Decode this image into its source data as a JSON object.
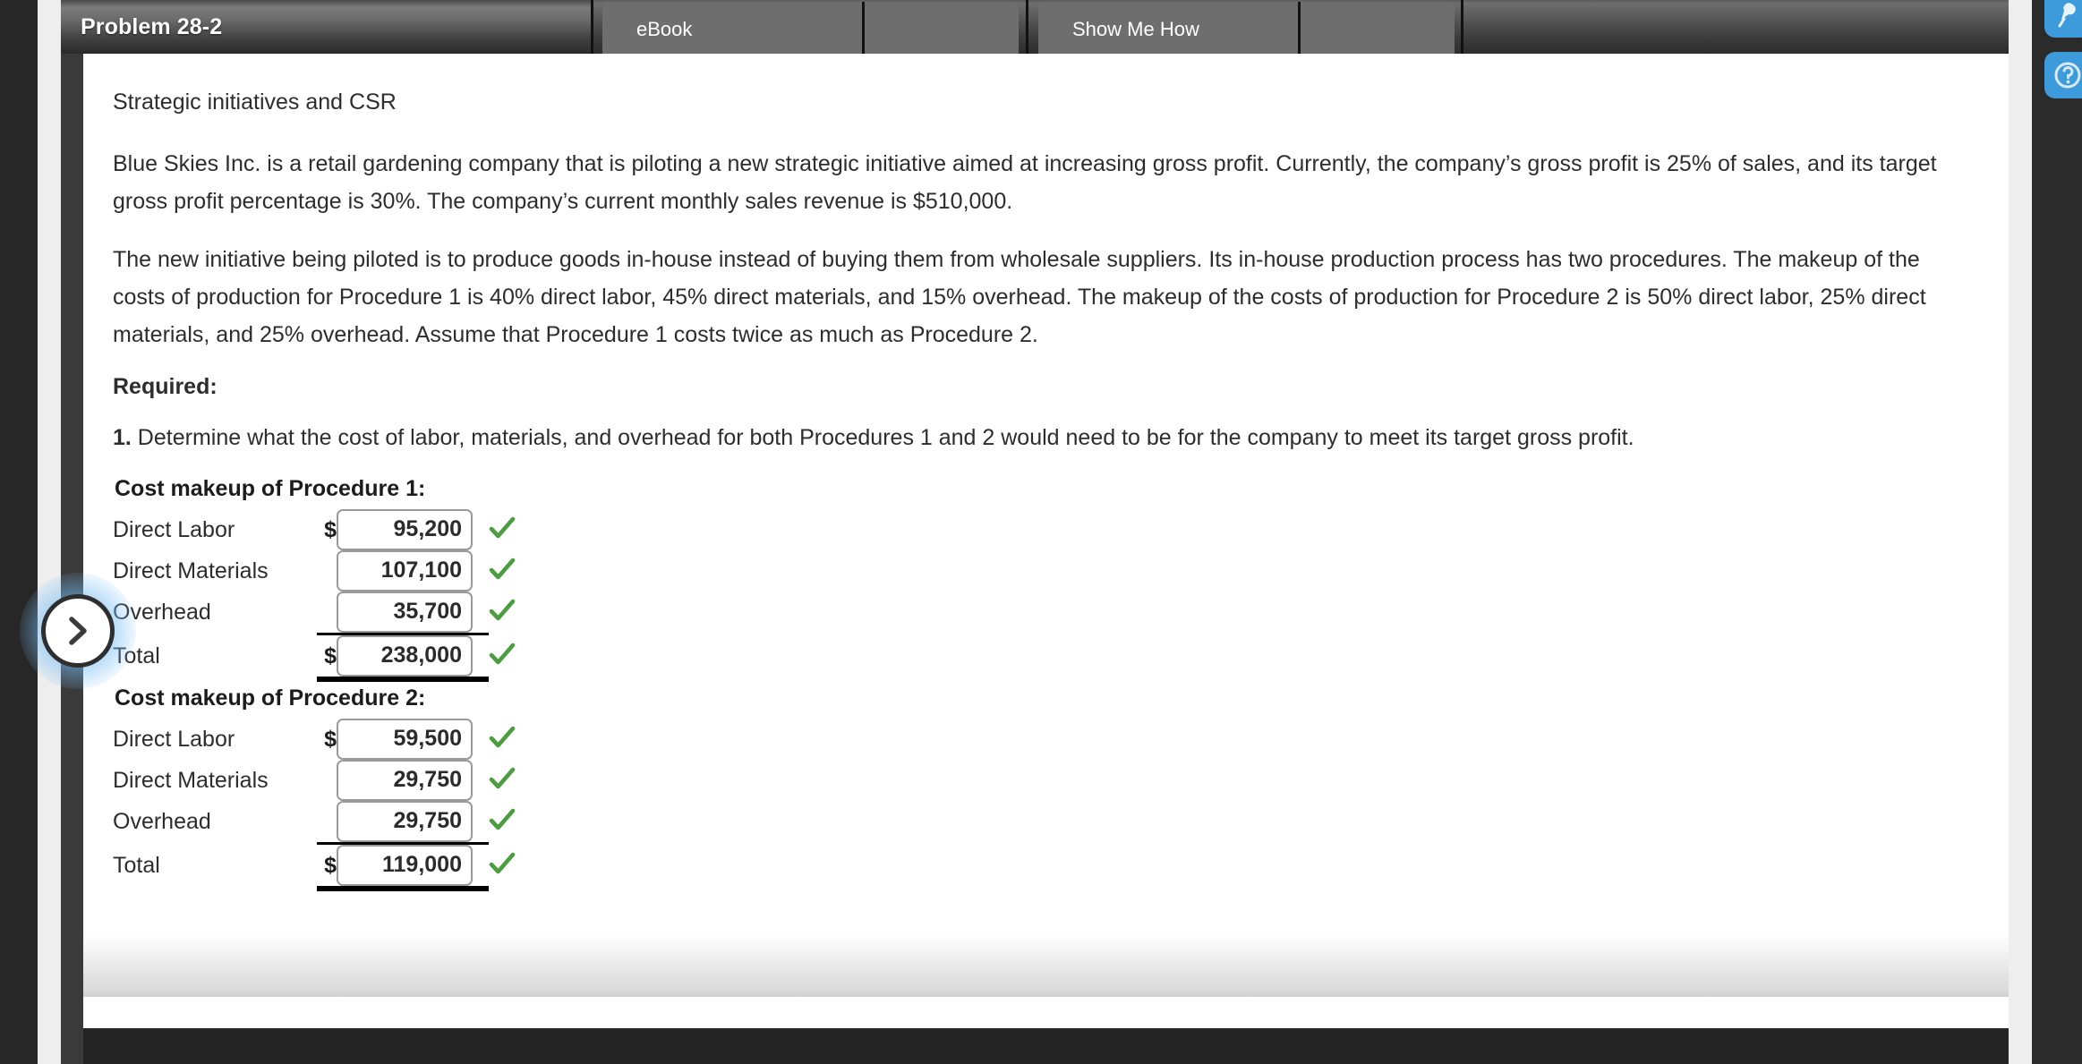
{
  "header": {
    "title": "Problem 28-2",
    "tools": [
      {
        "id": "ebook",
        "label": "eBook"
      },
      {
        "id": "show-me-how",
        "label": "Show Me How"
      }
    ]
  },
  "right_rail": {
    "items": [
      {
        "name": "pin-icon"
      },
      {
        "name": "help-circle-icon"
      }
    ],
    "color": "#3d9bdc"
  },
  "nav": {
    "next_label": "next-arrow"
  },
  "content": {
    "topic": "Strategic initiatives and CSR",
    "paragraph_1": "Blue Skies Inc. is a retail gardening company that is piloting a new strategic initiative aimed at increasing gross profit. Currently, the company’s gross profit is 25% of sales, and its target gross profit percentage is 30%. The company’s current monthly sales revenue is $510,000.",
    "paragraph_2": "The new initiative being piloted is to produce goods in-house instead of buying them from wholesale suppliers. Its in-house production process has two procedures. The makeup of the costs of production for Procedure 1 is 40% direct labor, 45% direct materials, and 15% overhead. The makeup of the costs of production for Procedure 2 is 50% direct labor, 25% direct materials, and 25% overhead. Assume that Procedure 1 costs twice as much as Procedure 2.",
    "required_heading": "Required:",
    "requirement_number": "1.",
    "requirement_text": " Determine what the cost of labor, materials, and overhead for both Procedures 1 and 2 would need to be for the company to meet its target gross profit."
  },
  "tables": [
    {
      "title": "Cost makeup of Procedure 1:",
      "rows": [
        {
          "label": "Direct Labor",
          "dollar": "$",
          "value": "95,200",
          "status": "correct"
        },
        {
          "label": "Direct Materials",
          "dollar": "",
          "value": "107,100",
          "status": "correct"
        },
        {
          "label": "Overhead",
          "dollar": "",
          "value": "35,700",
          "status": "correct"
        }
      ],
      "total": {
        "label": "Total",
        "dollar": "$",
        "value": "238,000",
        "status": "correct"
      }
    },
    {
      "title": "Cost makeup of Procedure 2:",
      "rows": [
        {
          "label": "Direct Labor",
          "dollar": "$",
          "value": "59,500",
          "status": "correct"
        },
        {
          "label": "Direct Materials",
          "dollar": "",
          "value": "29,750",
          "status": "correct"
        },
        {
          "label": "Overhead",
          "dollar": "",
          "value": "29,750",
          "status": "correct"
        }
      ],
      "total": {
        "label": "Total",
        "dollar": "$",
        "value": "119,000",
        "status": "correct"
      }
    }
  ],
  "colors": {
    "check_green": "#4a9e3f",
    "header_dark": "#3a3a3a",
    "tool_button": "#6e6e6e"
  }
}
